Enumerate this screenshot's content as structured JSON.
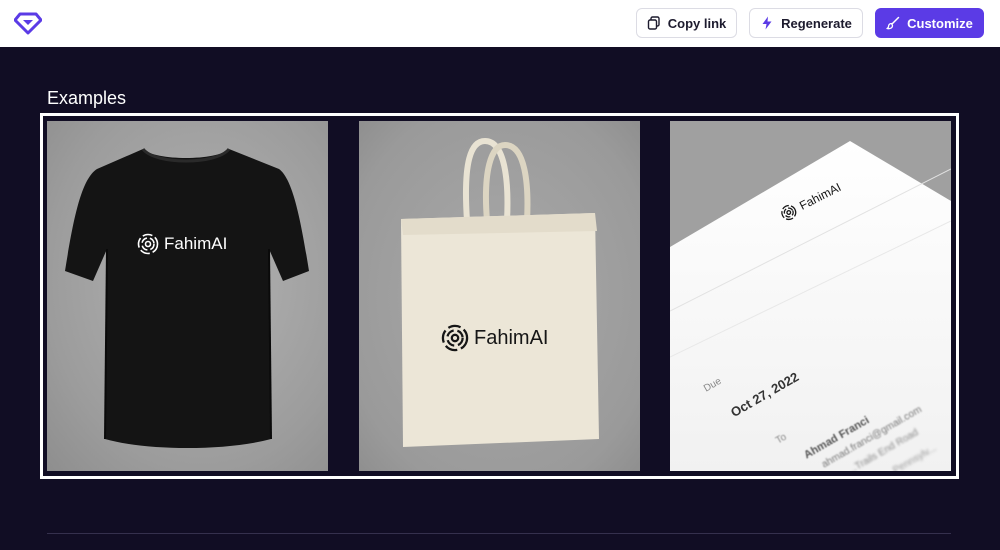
{
  "topbar": {
    "logo": "diamond-logo-icon",
    "copy_link_label": "Copy link",
    "regenerate_label": "Regenerate",
    "customize_label": "Customize",
    "accent_color": "#5b3be6"
  },
  "examples": {
    "title": "Examples",
    "items": [
      {
        "mockup": "black-tshirt",
        "brand": "FahimAI"
      },
      {
        "mockup": "canvas-tote-bag",
        "brand": "FahimAI"
      },
      {
        "mockup": "invoice-document",
        "brand": "FahimAI",
        "due_label": "Due",
        "due_date": "Oct 27, 2022",
        "to_label": "To",
        "recipient_name": "Ahmad Franci",
        "recipient_email": "ahmad.franci@gmail.com",
        "recipient_address_1": "...Trails End Road",
        "recipient_address_2": "...Pennsylv..."
      }
    ]
  },
  "colors": {
    "background": "#110d24",
    "topbar": "#ffffff"
  }
}
